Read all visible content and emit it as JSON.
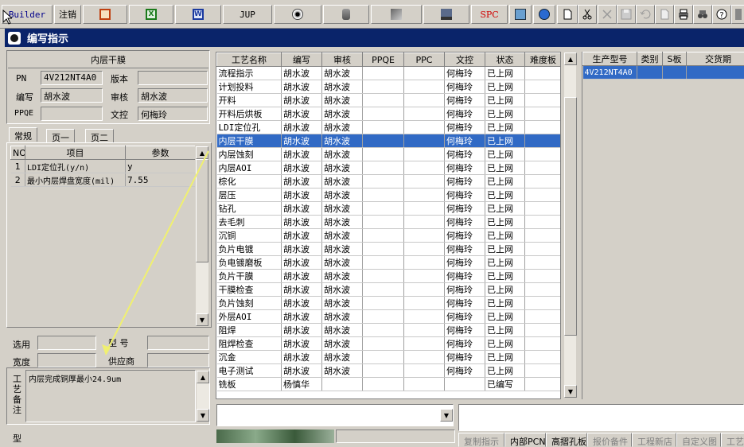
{
  "toolbar": {
    "builder_label": "Builder",
    "zhuxiao_label": "注销",
    "jup_label": "JUP",
    "spc_label": "SPC"
  },
  "window": {
    "title": "编写指示"
  },
  "left": {
    "process_title": "内层干膜",
    "pn_label": "PN",
    "pn_value": "4V212NT4A0",
    "version_label": "版本",
    "version_value": "",
    "editor_label": "编写",
    "editor_value": "胡水波",
    "reviewer_label": "审核",
    "reviewer_value": "胡水波",
    "ppqe_label": "PPQE",
    "ppqe_value": "",
    "wenkong_label": "文控",
    "wenkong_value": "何梅玲",
    "tabs": [
      "常规",
      "页一",
      "页二"
    ],
    "param_headers": [
      "NO",
      "项目",
      "参数"
    ],
    "params": [
      {
        "no": "1",
        "item": "LDI定位孔(y/n)",
        "value": "y"
      },
      {
        "no": "2",
        "item": "最小内层焊盘宽度(mil)",
        "value": "7.55"
      }
    ],
    "xuanyong_label": "选用",
    "xinghao_label": "型  号",
    "kuandu_label": "宽度",
    "gongyingshang_label": "供应商",
    "remark_label": "工艺备注",
    "remark_text": "内层完成铜厚最小24.9um",
    "bottom_label": "型"
  },
  "process_table": {
    "headers": [
      "工艺名称",
      "编写",
      "审核",
      "PPQE",
      "PPC",
      "文控",
      "状态",
      "难度板"
    ],
    "selected_index": 5,
    "rows": [
      [
        "流程指示",
        "胡水波",
        "胡水波",
        "",
        "",
        "何梅玲",
        "已上网",
        ""
      ],
      [
        "计划投料",
        "胡水波",
        "胡水波",
        "",
        "",
        "何梅玲",
        "已上网",
        ""
      ],
      [
        "开料",
        "胡水波",
        "胡水波",
        "",
        "",
        "何梅玲",
        "已上网",
        ""
      ],
      [
        "开料后烘板",
        "胡水波",
        "胡水波",
        "",
        "",
        "何梅玲",
        "已上网",
        ""
      ],
      [
        "LDI定位孔",
        "胡水波",
        "胡水波",
        "",
        "",
        "何梅玲",
        "已上网",
        ""
      ],
      [
        "内层干膜",
        "胡水波",
        "胡水波",
        "",
        "",
        "何梅玲",
        "已上网",
        ""
      ],
      [
        "内层蚀刻",
        "胡水波",
        "胡水波",
        "",
        "",
        "何梅玲",
        "已上网",
        ""
      ],
      [
        "内层AOI",
        "胡水波",
        "胡水波",
        "",
        "",
        "何梅玲",
        "已上网",
        ""
      ],
      [
        "棕化",
        "胡水波",
        "胡水波",
        "",
        "",
        "何梅玲",
        "已上网",
        ""
      ],
      [
        "层压",
        "胡水波",
        "胡水波",
        "",
        "",
        "何梅玲",
        "已上网",
        ""
      ],
      [
        "钻孔",
        "胡水波",
        "胡水波",
        "",
        "",
        "何梅玲",
        "已上网",
        ""
      ],
      [
        "去毛刺",
        "胡水波",
        "胡水波",
        "",
        "",
        "何梅玲",
        "已上网",
        ""
      ],
      [
        "沉铜",
        "胡水波",
        "胡水波",
        "",
        "",
        "何梅玲",
        "已上网",
        ""
      ],
      [
        "负片电镀",
        "胡水波",
        "胡水波",
        "",
        "",
        "何梅玲",
        "已上网",
        ""
      ],
      [
        "负电镀磨板",
        "胡水波",
        "胡水波",
        "",
        "",
        "何梅玲",
        "已上网",
        ""
      ],
      [
        "负片干膜",
        "胡水波",
        "胡水波",
        "",
        "",
        "何梅玲",
        "已上网",
        ""
      ],
      [
        "干膜检查",
        "胡水波",
        "胡水波",
        "",
        "",
        "何梅玲",
        "已上网",
        ""
      ],
      [
        "负片蚀刻",
        "胡水波",
        "胡水波",
        "",
        "",
        "何梅玲",
        "已上网",
        ""
      ],
      [
        "外层AOI",
        "胡水波",
        "胡水波",
        "",
        "",
        "何梅玲",
        "已上网",
        ""
      ],
      [
        "阻焊",
        "胡水波",
        "胡水波",
        "",
        "",
        "何梅玲",
        "已上网",
        ""
      ],
      [
        "阻焊检查",
        "胡水波",
        "胡水波",
        "",
        "",
        "何梅玲",
        "已上网",
        ""
      ],
      [
        "沉金",
        "胡水波",
        "胡水波",
        "",
        "",
        "何梅玲",
        "已上网",
        ""
      ],
      [
        "电子测试",
        "胡水波",
        "胡水波",
        "",
        "",
        "何梅玲",
        "已上网",
        ""
      ],
      [
        "铣板",
        "杨慎华",
        "",
        "",
        "",
        "",
        "已编写",
        ""
      ]
    ]
  },
  "product_table": {
    "headers": [
      "生产型号",
      "类别",
      "S板",
      "交货期"
    ],
    "rows": [
      [
        "4V212NT4A0",
        "",
        "",
        ""
      ]
    ]
  },
  "bottom_tabs": [
    "复制指示",
    "内部PCN",
    "高摺孔板",
    "报价备件",
    "工程新店",
    "自定义图",
    "工艺"
  ]
}
